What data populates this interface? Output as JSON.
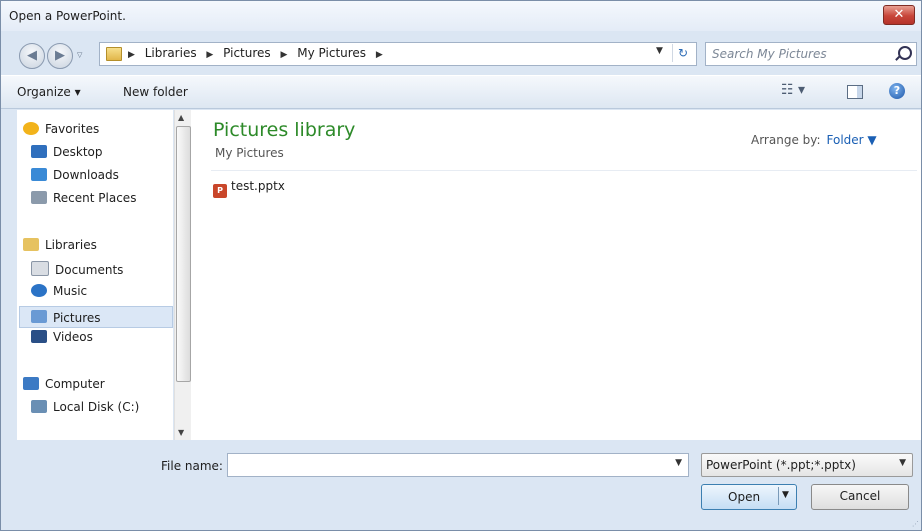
{
  "window": {
    "title": "Open a PowerPoint.",
    "close_glyph": "✕"
  },
  "nav": {
    "back_glyph": "◀",
    "forward_glyph": "▶",
    "recent_glyph": "▽",
    "breadcrumb": [
      "Libraries",
      "Pictures",
      "My Pictures"
    ],
    "breadcrumb_sep": "▶",
    "dropdown_glyph": "▼",
    "refresh_glyph": "↻",
    "search_placeholder": "Search My Pictures"
  },
  "toolbar": {
    "organize": "Organize ▾",
    "new_folder": "New folder",
    "views_glyph": "☷ ▾",
    "help_glyph": "?"
  },
  "sidebar": {
    "groups": [
      {
        "label": "Favorites",
        "icon": "star-icon",
        "color": "#f2b31b",
        "items": [
          {
            "label": "Desktop",
            "icon": "desktop-icon",
            "color": "#2f6fbd"
          },
          {
            "label": "Downloads",
            "icon": "downloads-icon",
            "color": "#3a8ad6"
          },
          {
            "label": "Recent Places",
            "icon": "recent-places-icon",
            "color": "#8b9aab"
          }
        ]
      },
      {
        "label": "Libraries",
        "icon": "libraries-icon",
        "color": "#e6c260",
        "items": [
          {
            "label": "Documents",
            "icon": "documents-icon",
            "color": "#d9dde3"
          },
          {
            "label": "Music",
            "icon": "music-icon",
            "color": "#2b73c6"
          },
          {
            "label": "Pictures",
            "icon": "pictures-icon",
            "color": "#6a9ad4",
            "selected": true
          },
          {
            "label": "Videos",
            "icon": "videos-icon",
            "color": "#2a4f86"
          }
        ]
      },
      {
        "label": "Computer",
        "icon": "computer-icon",
        "color": "#3c7ac4",
        "items": [
          {
            "label": "Local Disk (C:)",
            "icon": "local-disk-icon",
            "color": "#6a8fb4"
          }
        ]
      }
    ]
  },
  "content": {
    "title": "Pictures library",
    "subtitle": "My Pictures",
    "arrange_label": "Arrange by:",
    "arrange_value": "Folder ▼",
    "files": [
      {
        "name": "test.pptx",
        "icon": "pptx-file-icon",
        "badge": "P"
      }
    ]
  },
  "bottom": {
    "filename_label": "File name:",
    "filename_value": "",
    "filetype": "PowerPoint (*.ppt;*.pptx)",
    "open": "Open",
    "cancel": "Cancel"
  },
  "colors": {
    "library_title": "#2d8a29",
    "accent": "#1a5fb4",
    "close": "#c8453a"
  }
}
